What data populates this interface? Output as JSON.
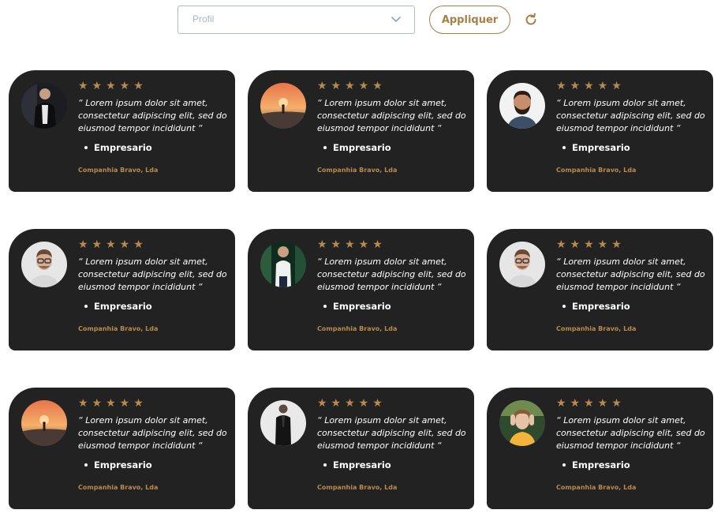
{
  "filter": {
    "select_value": "Profil",
    "apply_label": "Appliquer"
  },
  "cards": [
    {
      "avatar": "man-dark-suit",
      "rating": "★★★★★",
      "quote": "“ Lorem ipsum dolor sit amet, consectetur adipiscing elit, sed do eiusmod tempor incididunt “",
      "role": "Empresario",
      "company": "Companhia Bravo, Lda"
    },
    {
      "avatar": "sunset-silhouette",
      "rating": "★★★★★",
      "quote": "“ Lorem ipsum dolor sit amet, consectetur adipiscing elit, sed do eiusmod tempor incididunt “",
      "role": "Empresario",
      "company": "Companhia Bravo, Lda"
    },
    {
      "avatar": "bearded-man",
      "rating": "★★★★★",
      "quote": "“ Lorem ipsum dolor sit amet, consectetur adipiscing elit, sed do eiusmod tempor incididunt “",
      "role": "Empresario",
      "company": "Companhia Bravo, Lda"
    },
    {
      "avatar": "man-glasses",
      "rating": "★★★★★",
      "quote": "“ Lorem ipsum dolor sit amet, consectetur adipiscing elit, sed do eiusmod tempor incididunt “",
      "role": "Empresario",
      "company": "Companhia Bravo, Lda"
    },
    {
      "avatar": "man-white-shirt",
      "rating": "★★★★★",
      "quote": "“ Lorem ipsum dolor sit amet, consectetur adipiscing elit, sed do eiusmod tempor incididunt “",
      "role": "Empresario",
      "company": "Companhia Bravo, Lda"
    },
    {
      "avatar": "man-glasses",
      "rating": "★★★★★",
      "quote": "“ Lorem ipsum dolor sit amet, consectetur adipiscing elit, sed do eiusmod tempor incididunt “",
      "role": "Empresario",
      "company": "Companhia Bravo, Lda"
    },
    {
      "avatar": "sunset-silhouette",
      "rating": "★★★★★",
      "quote": "“ Lorem ipsum dolor sit amet, consectetur adipiscing elit, sed do eiusmod tempor incididunt “",
      "role": "Empresario",
      "company": "Companhia Bravo, Lda"
    },
    {
      "avatar": "man-black-coat",
      "rating": "★★★★★",
      "quote": "“ Lorem ipsum dolor sit amet, consectetur adipiscing elit, sed do eiusmod tempor incididunt “",
      "role": "Empresario",
      "company": "Companhia Bravo, Lda"
    },
    {
      "avatar": "woman-yellow",
      "rating": "★★★★★",
      "quote": "“ Lorem ipsum dolor sit amet, consectetur adipiscing elit, sed do eiusmod tempor incididunt “",
      "role": "Empresario",
      "company": "Companhia Bravo, Lda"
    }
  ],
  "colors": {
    "card_bg": "#222222",
    "accent": "#b88a4d",
    "button_border": "#a87f45"
  },
  "icons": {
    "select_caret": "chevron-down-icon",
    "refresh": "refresh-icon",
    "rating": "star-icon"
  }
}
